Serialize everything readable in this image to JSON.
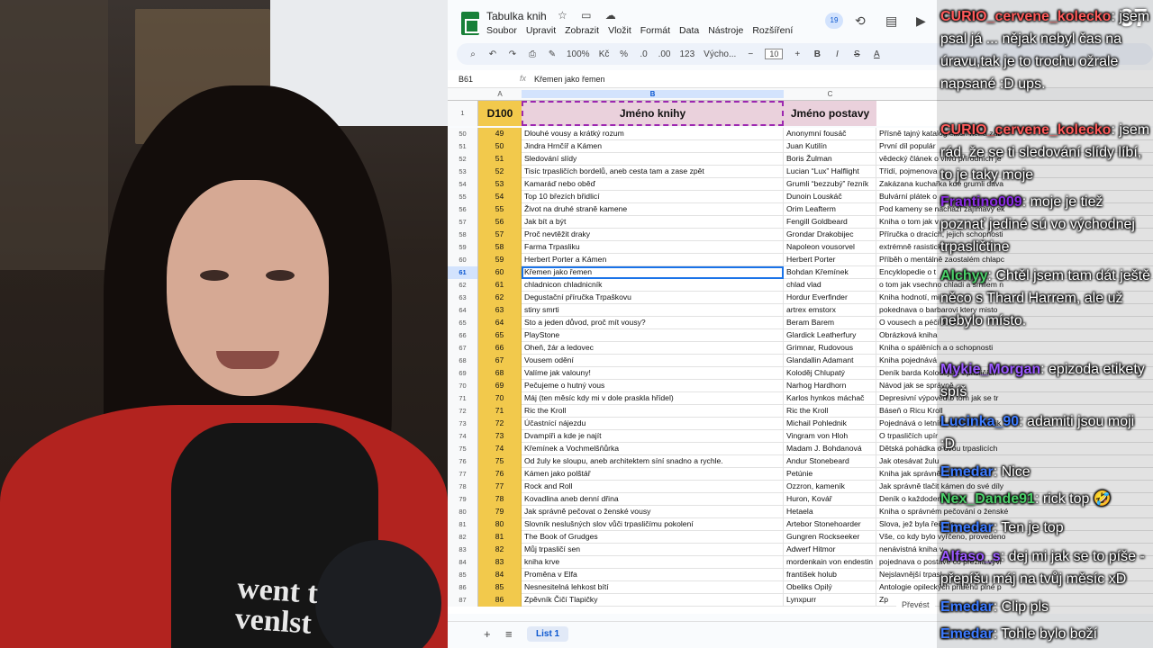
{
  "doc": {
    "title": "Tabulka knih",
    "menu": [
      "Soubor",
      "Upravit",
      "Zobrazit",
      "Vložit",
      "Formát",
      "Data",
      "Nástroje",
      "Rozšíření"
    ],
    "collaborators": "19"
  },
  "toolbar": {
    "zoom": "100%",
    "currency": "Kč",
    "percent": "%",
    "dec_less": ".0",
    "dec_more": ".00",
    "number_format": "123",
    "font": "Výcho...",
    "font_size": "10",
    "bold": "B",
    "italic": "I",
    "strike": "S",
    "text_color": "A"
  },
  "formula_bar": {
    "cell_ref": "B61",
    "fx": "fx",
    "value": "Křemen jako řemen"
  },
  "columns": [
    "A",
    "B",
    "C"
  ],
  "header_row": {
    "row": "1",
    "a": "D100",
    "b": "Jméno knihy",
    "c": "Jméno postavy"
  },
  "rows": [
    {
      "n": "50",
      "a": "49",
      "b": "Dlouhé vousy a krátký rozum",
      "c": "Anonymní fousáč",
      "d": "Přísně tajný katalog elitch her a zab"
    },
    {
      "n": "51",
      "a": "50",
      "b": "Jindra Hrnčíř a Kámen",
      "c": "Juan Kutilín",
      "d": "První díl populár"
    },
    {
      "n": "52",
      "a": "51",
      "b": "Sledování slídy",
      "c": "Boris Žulman",
      "d": "vědecký článek o vlivu přírodních je"
    },
    {
      "n": "53",
      "a": "52",
      "b": "Tisíc trpasličích bordelů, aneb cesta tam a zase zpět",
      "c": "Lucian “Lux” Halflight",
      "d": "Třídí, pojmenova"
    },
    {
      "n": "54",
      "a": "53",
      "b": "Kamaráď nebo oběď",
      "c": "Grumli “bezzubý” řezník",
      "d": "Zakázana kuchařka kde grumli dava"
    },
    {
      "n": "55",
      "a": "54",
      "b": "Top 10 březích břidlicí",
      "c": "Dunoin Louskáč",
      "d": "Bulvární plátek o"
    },
    {
      "n": "56",
      "a": "55",
      "b": "Život na druhé straně kamene",
      "c": "Orim Leafterm",
      "d": "Pod kameny se nachází zajímavy ek"
    },
    {
      "n": "57",
      "a": "56",
      "b": "Jak bít a být",
      "c": "Fengill Goldbeard",
      "d": "Kniha o tom jak v"
    },
    {
      "n": "58",
      "a": "57",
      "b": "Proč nevtěžit draky",
      "c": "Grondar Drakobijec",
      "d": "Příručka o dracích, jejich schopnosti"
    },
    {
      "n": "59",
      "a": "58",
      "b": "Farma Trpasliku",
      "c": "Napoleon vousorvel",
      "d": "extrémně rasistick"
    },
    {
      "n": "60",
      "a": "59",
      "b": "Herbert Porter a Kámen",
      "c": "Herbert Porter",
      "d": "Příběh o mentálně zaostalém chlapc"
    },
    {
      "n": "61",
      "a": "60",
      "b": "Křemen jako řemen",
      "c": "Bohdan Křemínek",
      "d": "Encyklopedie o t"
    },
    {
      "n": "62",
      "a": "61",
      "b": "chladnicon chladnicník",
      "c": "chlad vlad",
      "d": "o tom jak vsechno chladi a smilem n"
    },
    {
      "n": "63",
      "a": "62",
      "b": "Degustační příručka Trpaškovu",
      "c": "Hordur Everfinder",
      "d": "Kniha hodnotí, mi"
    },
    {
      "n": "64",
      "a": "63",
      "b": "stiny smrti",
      "c": "artrex emstorx",
      "d": "pokednava o barbarovi ktery misto"
    },
    {
      "n": "65",
      "a": "64",
      "b": "Sto a jeden důvod, proč mít vousy?",
      "c": "Beram Barem",
      "d": "O vousech a péči o ně"
    },
    {
      "n": "66",
      "a": "65",
      "b": "PlayStone",
      "c": "Glardick Leatherfury",
      "d": "Obrázková kniha"
    },
    {
      "n": "67",
      "a": "66",
      "b": "Oheň, žár a ledovec",
      "c": "Grimnar, Rudovous",
      "d": "Kniha o spálěních a o schopnosti"
    },
    {
      "n": "68",
      "a": "67",
      "b": "Vousem odění",
      "c": "Glandallin Adamant",
      "d": "Kniha pojednává"
    },
    {
      "n": "69",
      "a": "68",
      "b": "Valíme jak valouny!",
      "c": "Koloděj Chlupatý",
      "d": "Deník barda Koloděje z trpasličích"
    },
    {
      "n": "70",
      "a": "69",
      "b": "Pečujeme o hutný vous",
      "c": "Narhog Hardhorn",
      "d": "Návod jak se správně"
    },
    {
      "n": "71",
      "a": "70",
      "b": "Máj (ten měsíc kdy mi v dole praskla hřídel)",
      "c": "Karlos hynkos máchač",
      "d": "Depresivní výpověď o tom jak se tr"
    },
    {
      "n": "72",
      "a": "71",
      "b": "Ric the Kroll",
      "c": "Ric the Kroll",
      "d": "Báseň o Ricu Kroll"
    },
    {
      "n": "73",
      "a": "72",
      "b": "Účastnící nájezdu",
      "c": "Michail Pohlednik",
      "d": "Pojednává o letním nájezdu několik"
    },
    {
      "n": "74",
      "a": "73",
      "b": "Dvampíři a kde je najít",
      "c": "Vingram von Hloh",
      "d": "O trpasličích upír"
    },
    {
      "n": "75",
      "a": "74",
      "b": "Křemínek a Vochmelšňůrka",
      "c": "Madam J. Bohdanová",
      "d": "Dětská pohádka o dvou trpaslicích"
    },
    {
      "n": "76",
      "a": "75",
      "b": "Od žuly ke sloupu, aneb architektem síní snadno a rychle.",
      "c": "Andur Stonebeard",
      "d": "Jak otesávat žulu"
    },
    {
      "n": "77",
      "a": "76",
      "b": "Kámen jako polštář",
      "c": "Petúnie",
      "d": "Kniha jak správně spát v poloze"
    },
    {
      "n": "78",
      "a": "77",
      "b": "Rock and Roll",
      "c": "Ozzron, kameník",
      "d": "Jak správně tlačit kámen do své díly"
    },
    {
      "n": "79",
      "a": "78",
      "b": "Kovadlina aneb denní dřina",
      "c": "Huron, Kovář",
      "d": "Deník o každodenní práci"
    },
    {
      "n": "80",
      "a": "79",
      "b": "Jak správně pečovat o ženské vousy",
      "c": "Hetaela",
      "d": "Kniha o správném pečování o ženské"
    },
    {
      "n": "81",
      "a": "80",
      "b": "Slovník neslušných slov vůči trpasličímu pokolení",
      "c": "Artebor Stonehoarder",
      "d": "Slova, jež byla řečena"
    },
    {
      "n": "82",
      "a": "81",
      "b": "The Book of Grudges",
      "c": "Gungren Rockseeker",
      "d": "Vše, co kdy bylo vyřčeno, provedeno"
    },
    {
      "n": "83",
      "a": "82",
      "b": "Můj trpasličí sen",
      "c": "Adwerf Hitmor",
      "d": "nenávistná kniha v"
    },
    {
      "n": "84",
      "a": "83",
      "b": "kniha krve",
      "c": "mordenkain von endestin",
      "d": "pojednava o postave co prezila vyvr"
    },
    {
      "n": "85",
      "a": "84",
      "b": "Proměna v Elfa",
      "c": "františek holub",
      "d": "Nejslavnější trpasl"
    },
    {
      "n": "86",
      "a": "85",
      "b": "Nesnesitelná lehkost bítí",
      "c": "Obeliks Opilý",
      "d": "Antologie opileckých příběhů plné p"
    },
    {
      "n": "87",
      "a": "86",
      "b": "Zpěvník Čičí Tlapičky",
      "c": "Lynxpurr",
      "d": "Zp"
    }
  ],
  "bottom": {
    "sheet_tab": "List 1",
    "convert": "Převést"
  },
  "chat": {
    "counter": "37",
    "messages": [
      {
        "user": "CURIO_cervene_kolecko",
        "text": ": jsem psal já ... nějak nebyl čas na úravu,tak je to trochu ožrale napsané :D ups.",
        "color": "#ff5a5a"
      },
      {
        "user": "CURIO_cervene_kolecko",
        "text": ": jsem rád, že se ti sledování slídy líbí, to je taky moje",
        "color": "#ff5a5a"
      },
      {
        "user": "Frantino009",
        "text": ": moje je tiež poznať jediné sú vo východnej trpasličtine",
        "color": "#8a2be2"
      },
      {
        "user": "Alchyy",
        "text": ": Chtěl jsem tam dát ještě něco s Thard Harrem, ale už nebylo místo.",
        "color": "#4bd16a"
      },
      {
        "user": "Mykie_Morgan",
        "text": ": epizoda etikety spíš",
        "color": "#9b59ff"
      },
      {
        "user": "Lucinka_90",
        "text": ": adamiti jsou moji :D",
        "color": "#3d7bff"
      },
      {
        "user": "Emedar",
        "text": ": Nice",
        "color": "#3d7bff"
      },
      {
        "user": "Nex_Dande91",
        "text": ": rick top 🤣",
        "color": "#4bd16a"
      },
      {
        "user": "Emedar",
        "text": ": Ten je top",
        "color": "#3d7bff"
      },
      {
        "user": "Alfaso_s",
        "text": ": dej mi jak se to píše - přepíšu máj na tvůj měsíc xD",
        "color": "#9b59ff"
      },
      {
        "user": "Emedar",
        "text": ": Clip pls",
        "color": "#3d7bff"
      },
      {
        "user": "Emedar",
        "text": ": Tohle bylo boží",
        "color": "#3d7bff"
      }
    ]
  }
}
